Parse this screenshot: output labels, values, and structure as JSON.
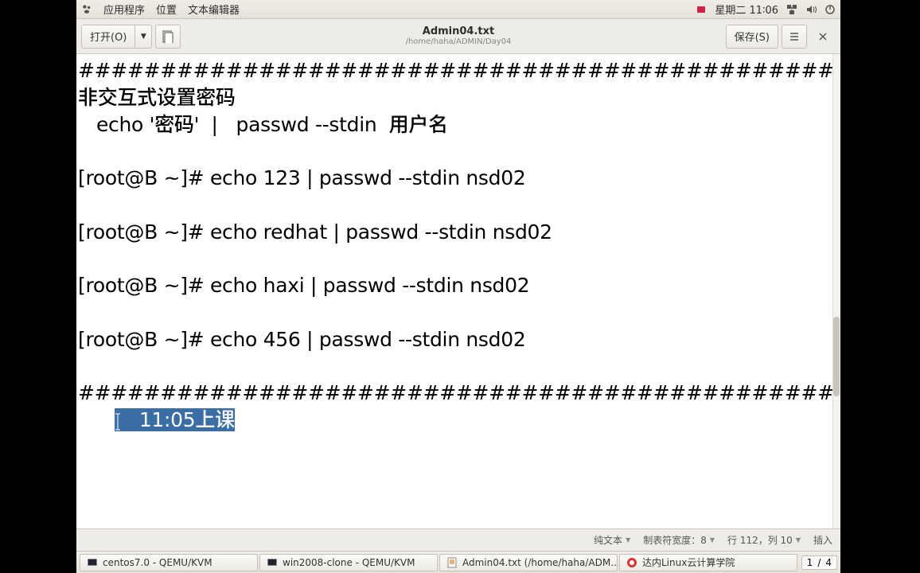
{
  "topbar": {
    "menus": {
      "applications": "应用程序",
      "places": "位置",
      "app": "文本编辑器"
    },
    "datetime": "星期二 11∶06"
  },
  "toolbar": {
    "open_label": "打开(O)",
    "save_label": "保存(S)"
  },
  "title": {
    "main": "Admin04.txt",
    "sub": "/home/haha/ADMIN/Day04"
  },
  "content": {
    "rule1": "########################################################",
    "line_heading": "非交互式设置密码",
    "line_example": "   echo '密码'  |   passwd --stdin  用户名",
    "blank": "",
    "cmd1": "[root@B ~]# echo 123 | passwd --stdin nsd02",
    "cmd2": "[root@B ~]# echo redhat | passwd --stdin nsd02",
    "cmd3": "[root@B ~]# echo haxi | passwd --stdin nsd02",
    "cmd4": "[root@B ~]# echo 456 | passwd --stdin nsd02",
    "rule2": "#######################################################",
    "selected_prefix": "      ",
    "selected_text": "   11:05上课"
  },
  "status": {
    "syntax": "纯文本",
    "tabwidth": "制表符宽度：8",
    "linecol": "行 112，列 10",
    "insert": "插入"
  },
  "taskbar": {
    "items": [
      "centos7.0 - QEMU/KVM",
      "win2008-clone - QEMU/KVM",
      "Admin04.txt (/home/haha/ADM…",
      "达内Linux云计算学院"
    ],
    "workspace": {
      "current": "1",
      "total": "4"
    }
  }
}
